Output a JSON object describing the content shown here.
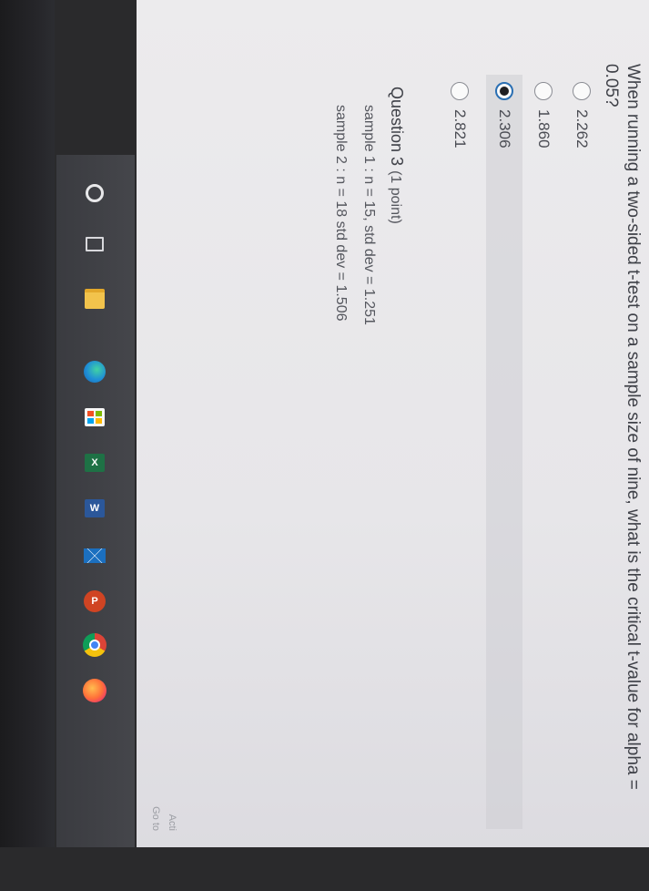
{
  "question": {
    "text": "When running a two-sided t-test on a sample size of nine, what is the critical t-value for alpha = 0.05?"
  },
  "options": [
    {
      "label": "2.262",
      "selected": false
    },
    {
      "label": "1.860",
      "selected": false
    },
    {
      "label": "2.306",
      "selected": true
    },
    {
      "label": "2.821",
      "selected": false
    }
  ],
  "question3": {
    "title": "Question 3",
    "points": "(1 point)",
    "line1": "sample 1 : n = 15, std dev = 1.251",
    "line2": "sample 2 : n = 18  std dev = 1.506"
  },
  "watermark": {
    "line1": "Acti",
    "line2": "Go to"
  },
  "taskbar": {
    "icons": [
      "start-icon",
      "task-view-icon",
      "file-explorer-icon",
      "edge-icon",
      "store-icon",
      "excel-icon",
      "word-icon",
      "mail-icon",
      "powerpoint-icon",
      "chrome-icon",
      "firefox-icon"
    ],
    "excel_letter": "X",
    "word_letter": "W",
    "ppt_letter": "P"
  },
  "colors": {
    "selected_radio_border": "#2a6fb3",
    "page_background": "#ecebed",
    "taskbar": "#3a3b40"
  }
}
